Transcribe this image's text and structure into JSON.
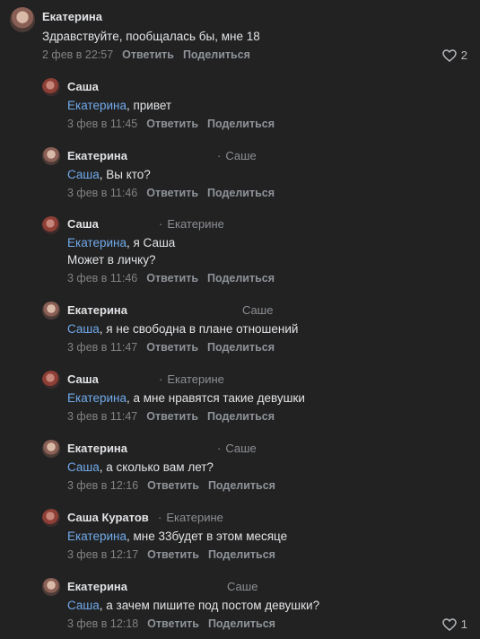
{
  "comments": [
    {
      "author": "Екатерина",
      "reply_to": "",
      "mention": "",
      "lines": [
        "Здравствуйте, пообщалась бы, мне 18"
      ],
      "date": "2 фев в 22:57",
      "reply": "Ответить",
      "share": "Поделиться",
      "likes": "2"
    },
    {
      "author": "Саша",
      "reply_to": "",
      "mention": "Екатерина",
      "lines": [
        ", привет"
      ],
      "date": "3 фев в 11:45",
      "reply": "Ответить",
      "share": "Поделиться",
      "likes": ""
    },
    {
      "author": "Екатерина",
      "reply_to": "Саше",
      "mention": "Саша",
      "lines": [
        ", Вы кто?"
      ],
      "date": "3 фев в 11:46",
      "reply": "Ответить",
      "share": "Поделиться",
      "likes": ""
    },
    {
      "author": "Саша",
      "reply_to": "Екатерине",
      "mention": "Екатерина",
      "lines": [
        ", я Саша",
        "Может в личку?"
      ],
      "date": "3 фев в 11:46",
      "reply": "Ответить",
      "share": "Поделиться",
      "likes": ""
    },
    {
      "author": "Екатерина",
      "reply_to": "Саше",
      "mention": "Саша",
      "lines": [
        ", я не свободна в плане отношений"
      ],
      "date": "3 фев в 11:47",
      "reply": "Ответить",
      "share": "Поделиться",
      "likes": ""
    },
    {
      "author": "Саша",
      "reply_to": "Екатерине",
      "mention": "Екатерина",
      "lines": [
        ", а мне нравятся такие девушки"
      ],
      "date": "3 фев в 11:47",
      "reply": "Ответить",
      "share": "Поделиться",
      "likes": ""
    },
    {
      "author": "Екатерина",
      "reply_to": "Саше",
      "mention": "Саша",
      "lines": [
        ", а сколько вам лет?"
      ],
      "date": "3 фев в 12:16",
      "reply": "Ответить",
      "share": "Поделиться",
      "likes": ""
    },
    {
      "author": "Саша Куратов",
      "reply_to": "Екатерине",
      "mention": "Екатерина",
      "lines": [
        ", мне 33будет в этом месяце"
      ],
      "date": "3 фев в 12:17",
      "reply": "Ответить",
      "share": "Поделиться",
      "likes": ""
    },
    {
      "author": "Екатерина",
      "reply_to": "Саше",
      "mention": "Саша",
      "lines": [
        ", а зачем пишите под постом девушки?"
      ],
      "date": "3 фев в 12:18",
      "reply": "Ответить",
      "share": "Поделиться",
      "likes": "1"
    }
  ]
}
